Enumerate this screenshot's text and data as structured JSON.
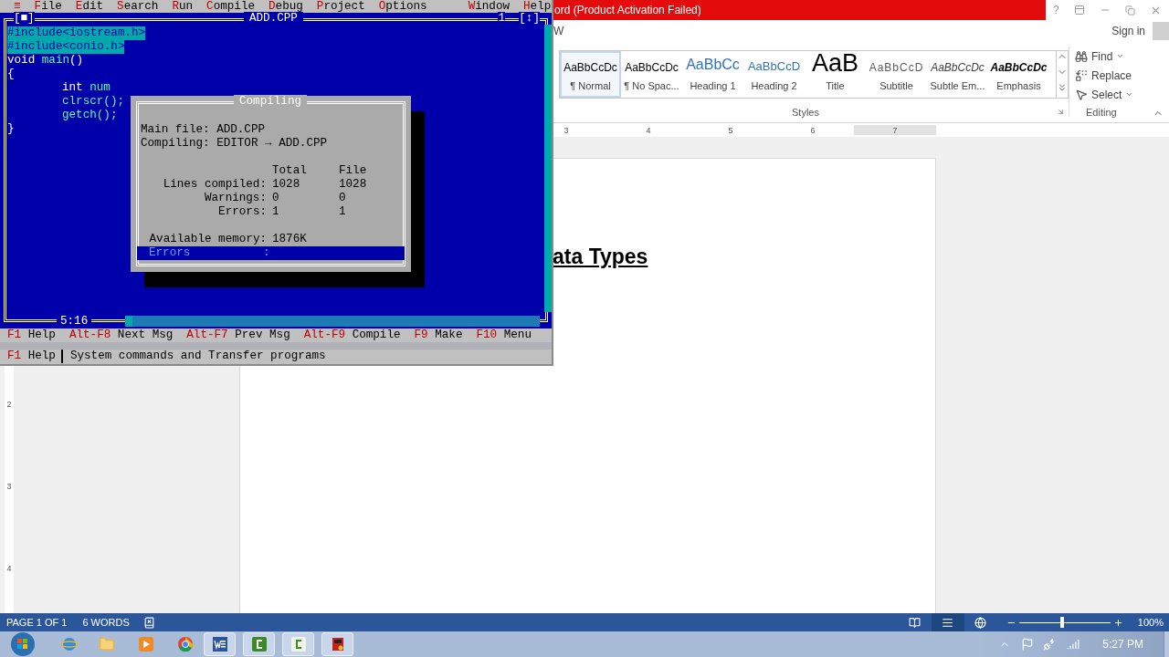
{
  "dos": {
    "menu": [
      {
        "label": "≡"
      },
      {
        "label": "File"
      },
      {
        "label": "Edit"
      },
      {
        "label": "Search"
      },
      {
        "label": "Run"
      },
      {
        "label": "Compile"
      },
      {
        "label": "Debug"
      },
      {
        "label": "Project"
      },
      {
        "label": "Options"
      }
    ],
    "menu_right": [
      {
        "label": "Window"
      },
      {
        "label": "Help"
      }
    ],
    "editor": {
      "close_box": "[■]",
      "title": "ADD.CPP",
      "window_number": "1",
      "zoom_box": "[↕]",
      "cursor_position": "5:16",
      "lines": [
        {
          "selected": true,
          "indented": false,
          "tokens": [
            {
              "text": "#include<iostream.h>",
              "kind": "directive"
            }
          ]
        },
        {
          "selected": true,
          "indented": false,
          "tokens": [
            {
              "text": "#include<conio.h>",
              "kind": "directive"
            }
          ]
        },
        {
          "selected": false,
          "indented": false,
          "tokens": [
            {
              "text": "void ",
              "kind": "keyword"
            },
            {
              "text": "main",
              "kind": "ident"
            },
            {
              "text": "()",
              "kind": "symbol"
            }
          ]
        },
        {
          "selected": false,
          "indented": false,
          "tokens": [
            {
              "text": "{",
              "kind": "symbol"
            }
          ]
        },
        {
          "selected": false,
          "indented": true,
          "tokens": [
            {
              "text": "int ",
              "kind": "keyword"
            },
            {
              "text": "num",
              "kind": "ident"
            }
          ]
        },
        {
          "selected": false,
          "indented": true,
          "tokens": [
            {
              "text": "clrscr();",
              "kind": "ident"
            }
          ]
        },
        {
          "selected": false,
          "indented": true,
          "tokens": [
            {
              "text": "getch();",
              "kind": "ident"
            }
          ]
        },
        {
          "selected": false,
          "indented": false,
          "tokens": [
            {
              "text": "}",
              "kind": "symbol"
            }
          ]
        }
      ]
    },
    "dialog": {
      "title": "Compiling",
      "info": [
        "Main file: ADD.CPP",
        "Compiling: EDITOR → ADD.CPP"
      ],
      "columns": [
        "Total",
        "File"
      ],
      "rows": [
        {
          "label": "Lines compiled:",
          "total": "1028",
          "file": "1028"
        },
        {
          "label": "Warnings:",
          "total": "0",
          "file": "0"
        },
        {
          "label": "Errors:",
          "total": "1",
          "file": "1"
        }
      ],
      "memory": {
        "label": "Available memory:",
        "value": "1876K"
      },
      "message_bar": {
        "label": "Errors",
        "separator": ":"
      }
    },
    "hints": [
      {
        "key": "F1",
        "label": "Help"
      },
      {
        "key": "Alt-F8",
        "label": "Next Msg"
      },
      {
        "key": "Alt-F7",
        "label": "Prev Msg"
      },
      {
        "key": "Alt-F9",
        "label": "Compile"
      },
      {
        "key": "F9",
        "label": "Make"
      },
      {
        "key": "F10",
        "label": "Menu"
      }
    ],
    "status": {
      "key": "F1",
      "label": "Help",
      "message": "System commands and Transfer programs"
    }
  },
  "word": {
    "title": "ord (Product Activation Failed)",
    "help": "?",
    "tab": "W",
    "sign_in": "Sign in",
    "styles": [
      {
        "preview": "AaBbCcDc",
        "name": "¶ Normal",
        "kind": "normal",
        "selected": true
      },
      {
        "preview": "AaBbCcDc",
        "name": "¶ No Spac...",
        "kind": "nospacing",
        "selected": false
      },
      {
        "preview": "AaBbCc",
        "name": "Heading 1",
        "kind": "heading1",
        "selected": false
      },
      {
        "preview": "AaBbCcD",
        "name": "Heading 2",
        "kind": "heading2",
        "selected": false
      },
      {
        "preview": "AaB",
        "name": "Title",
        "kind": "title",
        "selected": false
      },
      {
        "preview": "AaBbCcD",
        "name": "Subtitle",
        "kind": "subtitle",
        "selected": false
      },
      {
        "preview": "AaBbCcDc",
        "name": "Subtle Em...",
        "kind": "subtle",
        "selected": false
      },
      {
        "preview": "AaBbCcDc",
        "name": "Emphasis",
        "kind": "emphasis",
        "selected": false
      }
    ],
    "styles_label": "Styles",
    "editing": [
      {
        "label": "Find",
        "kind": "find",
        "dropdown": true
      },
      {
        "label": "Replace",
        "kind": "replace",
        "dropdown": false
      },
      {
        "label": "Select",
        "kind": "select",
        "dropdown": true
      }
    ],
    "editing_label": "Editing",
    "ruler": [
      "3",
      "4",
      "5",
      "6",
      "7"
    ],
    "vertical_ruler": [
      "2",
      "3",
      "4"
    ],
    "heading": "ata Types",
    "status": {
      "page": "PAGE 1 OF 1",
      "words": "6 WORDS"
    },
    "views": [
      {
        "kind": "read",
        "selected": false
      },
      {
        "kind": "print",
        "selected": true
      },
      {
        "kind": "web",
        "selected": false
      }
    ],
    "zoom": {
      "level": 0.47,
      "reading": "100%"
    }
  },
  "taskbar": {
    "clock": "5:27 PM"
  }
}
